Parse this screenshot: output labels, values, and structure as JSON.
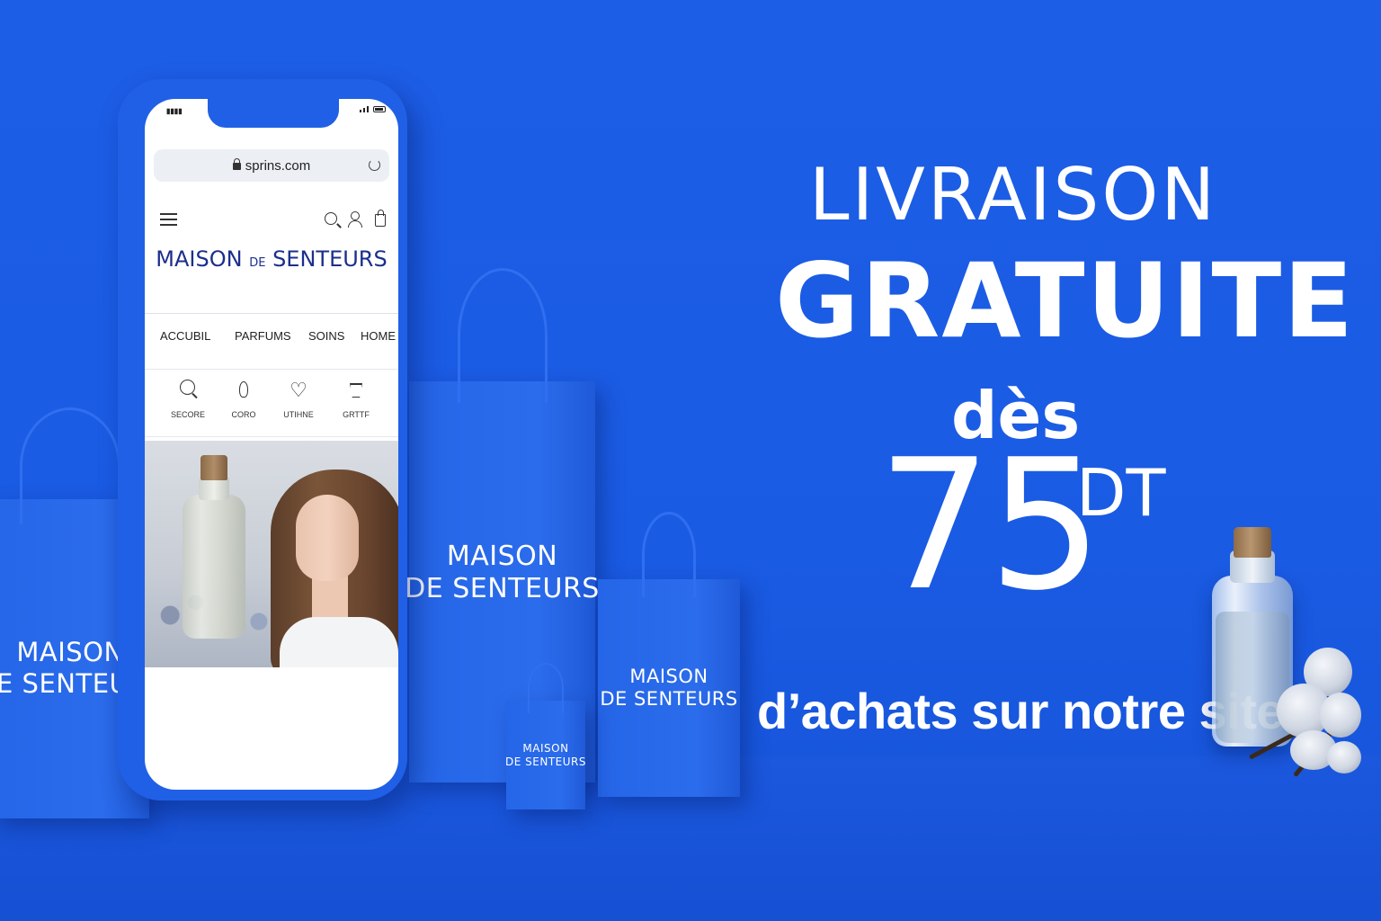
{
  "phone": {
    "url": "sprins.com",
    "brand": {
      "main1": "MAISON ",
      "small": "DE",
      "main2": " SENTEURS"
    },
    "menu": [
      "ACCUBIL",
      "PARFUMS",
      "SOINS",
      "HOME"
    ],
    "categories": [
      {
        "label": "SECORE",
        "icon": "search-icon"
      },
      {
        "label": "CORO",
        "icon": "drop-icon"
      },
      {
        "label": "UTIHNE",
        "icon": "heart-icon"
      },
      {
        "label": "GRTTF",
        "icon": "cup-icon"
      }
    ]
  },
  "bags": [
    {
      "line1": "MAISON",
      "line2": "DE SENTEURS"
    },
    {
      "line1": "MAISON",
      "line2": "DE SENTEURS"
    },
    {
      "line1": "MAISON",
      "line2": "DE SENTEURS"
    },
    {
      "line1": "MAISON",
      "line2": "DE SENTEURS"
    }
  ],
  "headline": {
    "line1": "LIVRAISON",
    "line2": "GRATUITE",
    "line3": "dès",
    "amount": "75",
    "currency": "DT",
    "line4": "d’achats sur notre site"
  },
  "colors": {
    "background": "#1a5be3",
    "text": "#ffffff",
    "brand_navy": "#1b2f8c"
  }
}
